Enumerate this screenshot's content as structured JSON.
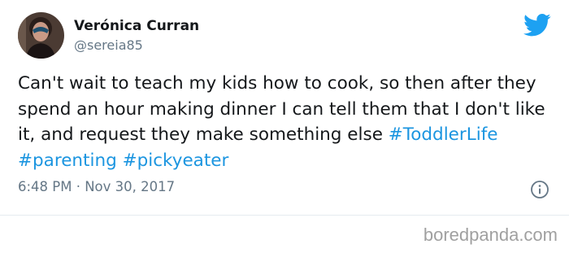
{
  "tweet": {
    "author_name": "Verónica Curran",
    "author_handle": "@sereia85",
    "text_before": "Can't wait to teach my kids how to cook, so then after they spend an hour making dinner I can tell them that I don't like it, and request they make something else ",
    "hashtags": [
      "#ToddlerLife",
      "#parenting",
      "#pickyeater"
    ],
    "timestamp": "6:48 PM · Nov 30, 2017",
    "icons": {
      "avatar": "profile-photo",
      "brand": "twitter-bird-icon",
      "info": "info-icon"
    },
    "colors": {
      "hashtag": "#1b95e0",
      "brand": "#1da1f2",
      "muted": "#657786",
      "text": "#14171a"
    }
  },
  "watermark": "boredpanda.com"
}
